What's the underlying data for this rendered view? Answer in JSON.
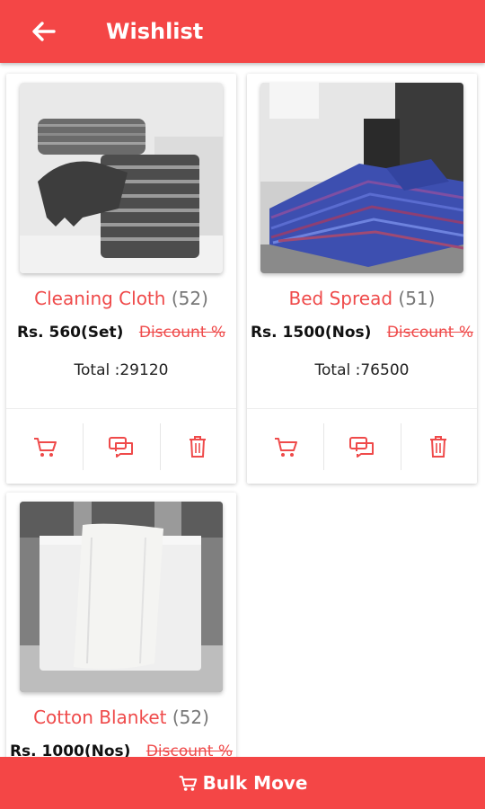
{
  "header": {
    "title": "Wishlist",
    "back_icon": "arrow-left-icon"
  },
  "colors": {
    "accent": "#f44646",
    "name_text": "#ef4a4a",
    "count_text": "#777777"
  },
  "products": [
    {
      "name": "Cleaning Cloth",
      "count": "(52)",
      "price": "Rs. 560(Set)",
      "discount": "Discount %",
      "total": "Total :29120",
      "image": "folded-cleaning-cloths-photo"
    },
    {
      "name": "Bed Spread",
      "count": "(51)",
      "price": "Rs. 1500(Nos)",
      "discount": "Discount %",
      "total": "Total :76500",
      "image": "blue-striped-bed-spread-photo"
    },
    {
      "name": "Cotton Blanket",
      "count": "(52)",
      "price": "Rs. 1000(Nos)",
      "discount": "Discount %",
      "image": "white-cotton-blanket-photo"
    }
  ],
  "card_actions": [
    "cart-icon",
    "chat-icon",
    "trash-icon"
  ],
  "bottom_bar": {
    "label": "Bulk Move",
    "icon": "cart-icon"
  }
}
